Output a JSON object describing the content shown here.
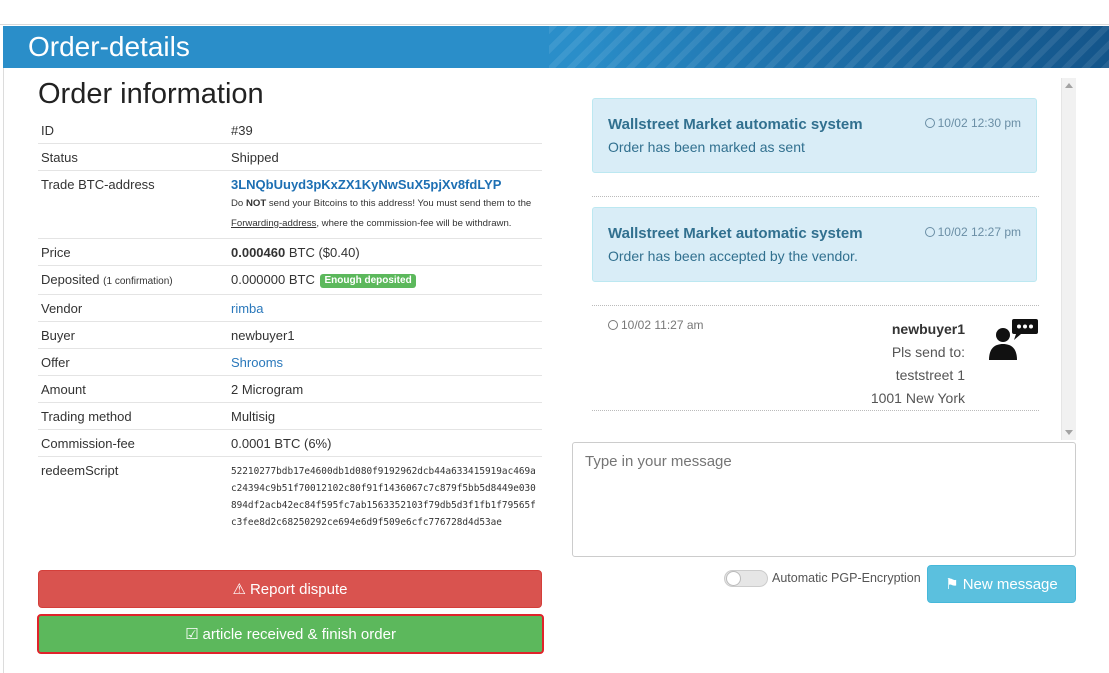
{
  "header": {
    "title": "Order-details"
  },
  "order": {
    "section_title": "Order information",
    "rows": {
      "id": {
        "label": "ID",
        "value": "#39"
      },
      "status": {
        "label": "Status",
        "value": "Shipped"
      },
      "trade_address": {
        "label": "Trade BTC-address",
        "value": "3LNQbUuyd3pKxZX1KyNwSuX5pjXv8fdLYP",
        "warn_1": "Do ",
        "warn_bold": "NOT",
        "warn_2": " send your Bitcoins to this address! You must send them to the ",
        "warn_link": "Forwarding-address",
        "warn_3": ", where the commission-fee will be withdrawn."
      },
      "price": {
        "label": "Price",
        "amount": "0.000460",
        "rest": " BTC ($0.40)"
      },
      "deposited": {
        "label": "Deposited",
        "note": "(1  confirmation)",
        "value": "0.000000 BTC",
        "badge": "Enough deposited"
      },
      "vendor": {
        "label": "Vendor",
        "value": "rimba"
      },
      "buyer": {
        "label": "Buyer",
        "value": "newbuyer1"
      },
      "offer": {
        "label": "Offer",
        "value": "Shrooms"
      },
      "amount": {
        "label": "Amount",
        "value": "2 Microgram"
      },
      "trading_method": {
        "label": "Trading method",
        "value": "Multisig"
      },
      "commission": {
        "label": "Commission-fee",
        "value": "0.0001 BTC (6%)"
      },
      "redeem": {
        "label": "redeemScript",
        "value": "52210277bdb17e4600db1d080f9192962dcb44a633415919ac469ac24394c9b51f70012102c80f91f1436067c7c879f5bb5d8449e030894df2acb42ec84f595fc7ab1563352103f79db5d3f1fb1f79565fc3fee8d2c68250292ce694e6d9f509e6cfc776728d4d53ae"
      }
    }
  },
  "actions": {
    "report_dispute": "Report dispute",
    "finish_order": "article received & finish order",
    "new_message": "New message"
  },
  "chat": {
    "messages": [
      {
        "sender": "Wallstreet Market automatic system",
        "text": "Order has been marked as sent",
        "time": "10/02 12:30 pm"
      },
      {
        "sender": "Wallstreet Market automatic system",
        "text": "Order has been accepted by the vendor.",
        "time": "10/02 12:27 pm"
      }
    ],
    "user_message": {
      "time": "10/02 11:27 am",
      "name": "newbuyer1",
      "lines": [
        "Pls send to:",
        "teststreet 1",
        "1001 New York"
      ]
    },
    "input_placeholder": "Type in your message",
    "pgp_label": "Automatic PGP-Encryption"
  },
  "colors": {
    "header_blue": "#2a8ec9",
    "danger": "#d9534f",
    "success": "#5cb85c",
    "info": "#5bc0de",
    "alert_bg": "#d9edf7",
    "link": "#1d6fb3"
  }
}
